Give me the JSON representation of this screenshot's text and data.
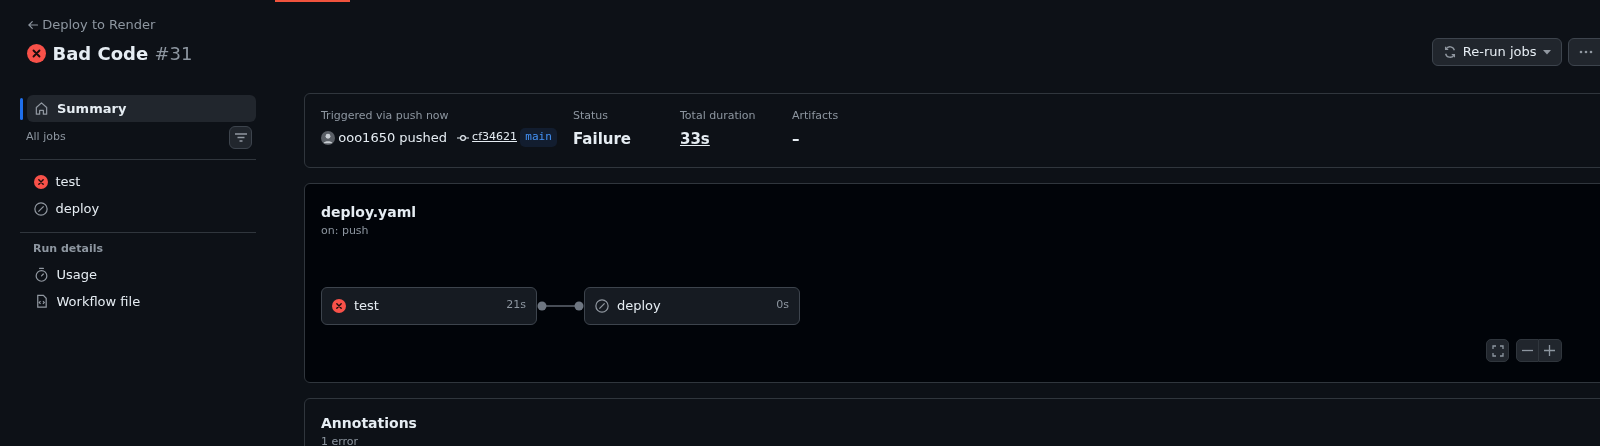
{
  "back_link": "Deploy to Render",
  "run": {
    "title": "Bad Code",
    "number": "#31",
    "failed": true
  },
  "header_buttons": {
    "rerun": "Re-run jobs"
  },
  "sidebar": {
    "summary": {
      "label": "Summary",
      "selected": true
    },
    "jobs_heading": "All jobs",
    "jobs": [
      {
        "name": "test",
        "kind": "failure",
        "selected": false
      },
      {
        "name": "deploy",
        "kind": "skipped",
        "selected": false
      }
    ],
    "details_heading": "Run details",
    "details": [
      {
        "label": "Usage",
        "kind": "usage",
        "selected": false
      },
      {
        "label": "Workflow file",
        "kind": "file",
        "selected": false
      }
    ]
  },
  "summary": {
    "trigger_label": "Triggered via push now",
    "actor": "ooo1650",
    "action": "pushed",
    "commit": "cf34621",
    "branch": "main",
    "status_label": "Status",
    "status": "Failure",
    "duration_label": "Total duration",
    "duration": "33s",
    "artifacts_label": "Artifacts",
    "artifacts": "–"
  },
  "workflow": {
    "file": "deploy.yaml",
    "trigger": "on: push",
    "jobs": [
      {
        "name": "test",
        "kind": "failure",
        "duration": "21s"
      },
      {
        "name": "deploy",
        "kind": "skipped",
        "duration": "0s"
      }
    ]
  },
  "annotations": {
    "title": "Annotations",
    "count": "1 error"
  }
}
